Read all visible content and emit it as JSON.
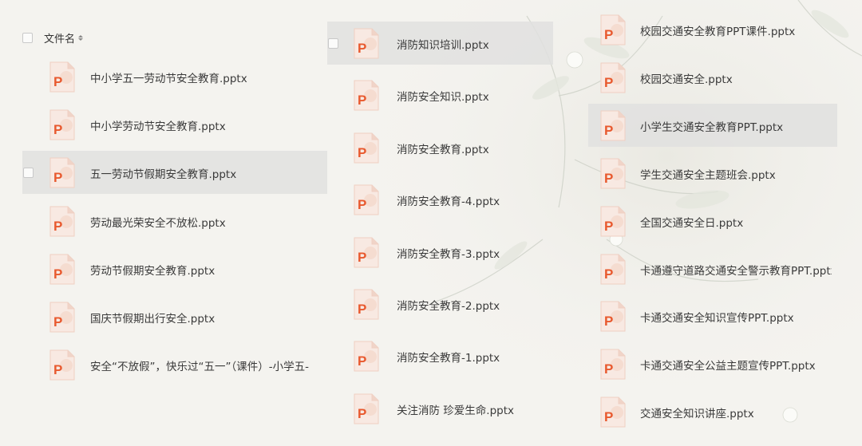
{
  "header": {
    "label": "文件名"
  },
  "columns": [
    {
      "files": [
        "中小学五一劳动节安全教育.pptx",
        "中小学劳动节安全教育.pptx",
        "五一劳动节假期安全教育.pptx",
        "劳动最光荣安全不放松.pptx",
        "劳动节假期安全教育.pptx",
        "国庆节假期出行安全.pptx",
        "安全“不放假”，快乐过“五一”（课件）-小学五-"
      ]
    },
    {
      "files": [
        "消防知识培训.pptx",
        "消防安全知识.pptx",
        "消防安全教育.pptx",
        "消防安全教育-4.pptx",
        "消防安全教育-3.pptx",
        "消防安全教育-2.pptx",
        "消防安全教育-1.pptx",
        "关注消防  珍爱生命.pptx"
      ]
    },
    {
      "files": [
        "校园交通安全教育PPT课件.pptx",
        "校园交通安全.pptx",
        "小学生交通安全教育PPT.pptx",
        "学生交通安全主题班会.pptx",
        "全国交通安全日.pptx",
        "卡通遵守道路交通安全警示教育PPT.pptx",
        "卡通交通安全知识宣传PPT.pptx",
        "卡通交通安全公益主题宣传PPT.pptx",
        "交通安全知识讲座.pptx"
      ]
    }
  ],
  "colors": {
    "icon_orange": "#e8592e",
    "icon_bg": "#f6e4dc",
    "highlight": "#e1e1df"
  },
  "icons": {
    "file": "powerpoint-file-icon",
    "sort": "sort-icon"
  }
}
